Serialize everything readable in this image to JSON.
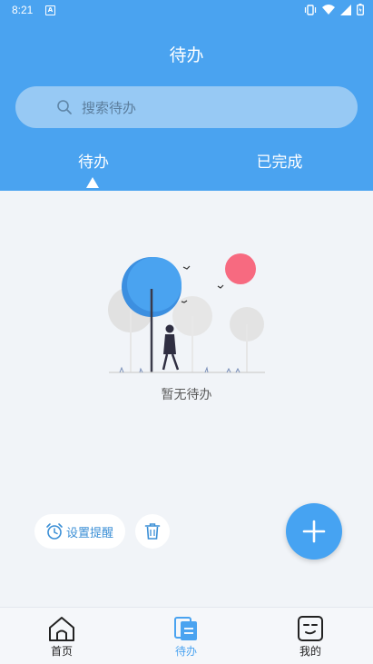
{
  "status_bar": {
    "time": "8:21",
    "notification_badge": "A"
  },
  "header": {
    "title": "待办"
  },
  "search": {
    "placeholder": "搜索待办"
  },
  "tabs": [
    {
      "label": "待办",
      "active": true
    },
    {
      "label": "已完成",
      "active": false
    }
  ],
  "empty_state": {
    "text": "暂无待办"
  },
  "actions": {
    "remind_label": "设置提醒"
  },
  "tabbar": [
    {
      "label": "首页",
      "icon": "home-icon",
      "active": false
    },
    {
      "label": "待办",
      "icon": "todo-list-icon",
      "active": true
    },
    {
      "label": "我的",
      "icon": "profile-face-icon",
      "active": false
    }
  ],
  "colors": {
    "primary": "#4aa3f0",
    "background": "#f1f4f8",
    "active_tab": "#4aa3f0",
    "inactive_tab": "#222222",
    "illustration_red": "#f76a80"
  }
}
